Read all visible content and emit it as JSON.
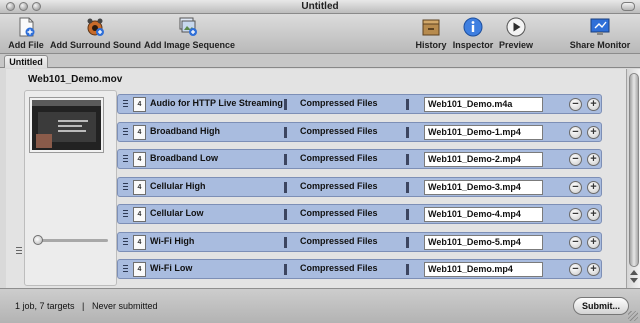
{
  "window": {
    "title": "Untitled"
  },
  "toolbar": {
    "add_file": "Add File",
    "add_surround": "Add Surround Sound",
    "add_image_sequence": "Add Image Sequence",
    "history": "History",
    "inspector": "Inspector",
    "preview": "Preview",
    "share_monitor": "Share Monitor"
  },
  "tab": {
    "label": "Untitled"
  },
  "job": {
    "source_filename": "Web101_Demo.mov",
    "targets": [
      {
        "setting": "Audio for HTTP Live Streaming",
        "destination": "Compressed Files",
        "output": "Web101_Demo.m4a"
      },
      {
        "setting": "Broadband High",
        "destination": "Compressed Files",
        "output": "Web101_Demo-1.mp4"
      },
      {
        "setting": "Broadband Low",
        "destination": "Compressed Files",
        "output": "Web101_Demo-2.mp4"
      },
      {
        "setting": "Cellular High",
        "destination": "Compressed Files",
        "output": "Web101_Demo-3.mp4"
      },
      {
        "setting": "Cellular Low",
        "destination": "Compressed Files",
        "output": "Web101_Demo-4.mp4"
      },
      {
        "setting": "Wi-Fi High",
        "destination": "Compressed Files",
        "output": "Web101_Demo-5.mp4"
      },
      {
        "setting": "Wi-Fi Low",
        "destination": "Compressed Files",
        "output": "Web101_Demo.mp4"
      }
    ],
    "doc_icon_glyph": "4",
    "minus_glyph": "−",
    "plus_glyph": "+"
  },
  "status": {
    "summary": "1 job, 7 targets",
    "separator": "|",
    "submission": "Never submitted",
    "submit_label": "Submit..."
  },
  "colors": {
    "row_fill": "#a9bcdf",
    "accent_blue": "#2f6fd8"
  }
}
